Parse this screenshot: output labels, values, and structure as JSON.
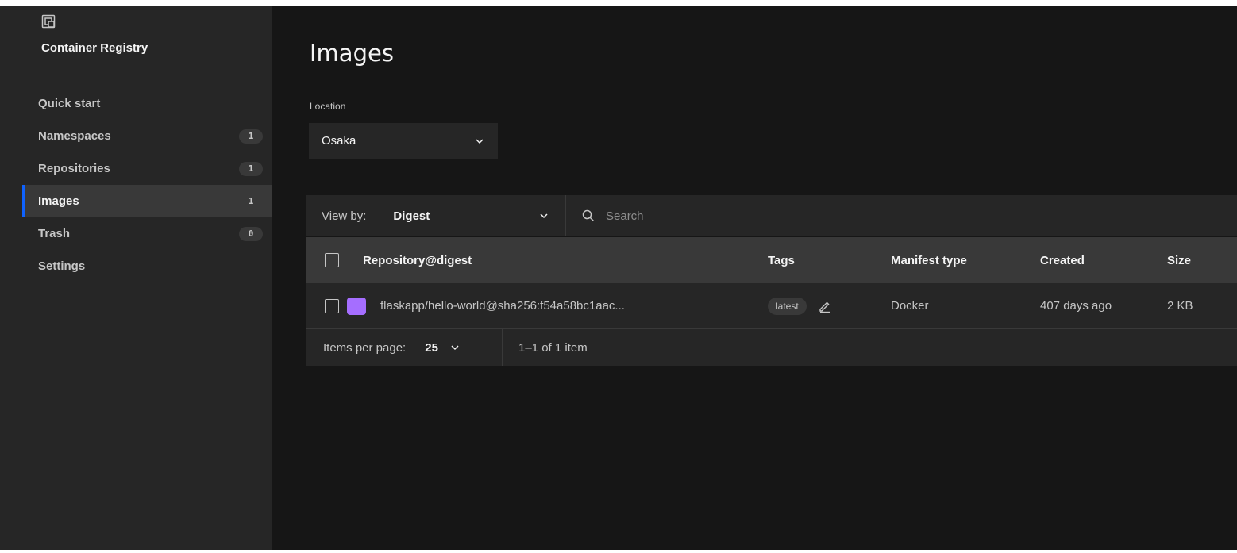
{
  "app": {
    "title": "Container Registry"
  },
  "sidebar": {
    "items": [
      {
        "label": "Quick start",
        "badge": ""
      },
      {
        "label": "Namespaces",
        "badge": "1"
      },
      {
        "label": "Repositories",
        "badge": "1"
      },
      {
        "label": "Images",
        "badge": "1",
        "active": true
      },
      {
        "label": "Trash",
        "badge": "0"
      },
      {
        "label": "Settings",
        "badge": ""
      }
    ]
  },
  "main": {
    "title": "Images",
    "location": {
      "label": "Location",
      "value": "Osaka"
    },
    "toolbar": {
      "view_by_label": "View by:",
      "view_by_value": "Digest",
      "search_placeholder": "Search"
    },
    "table": {
      "headers": {
        "repo": "Repository@digest",
        "tags": "Tags",
        "manifest": "Manifest type",
        "created": "Created",
        "size": "Size"
      },
      "rows": [
        {
          "repo": "flaskapp/hello-world@sha256:f54a58bc1aac...",
          "tag": "latest",
          "manifest": "Docker",
          "created": "407 days ago",
          "size": "2 KB",
          "swatch_color": "#a56eff"
        }
      ]
    },
    "pagination": {
      "items_per_page_label": "Items per page:",
      "items_per_page_value": "25",
      "range": "1–1 of 1 item"
    }
  },
  "colors": {
    "accent": "#0f62fe",
    "background": "#161616",
    "sidebar": "#262626"
  }
}
